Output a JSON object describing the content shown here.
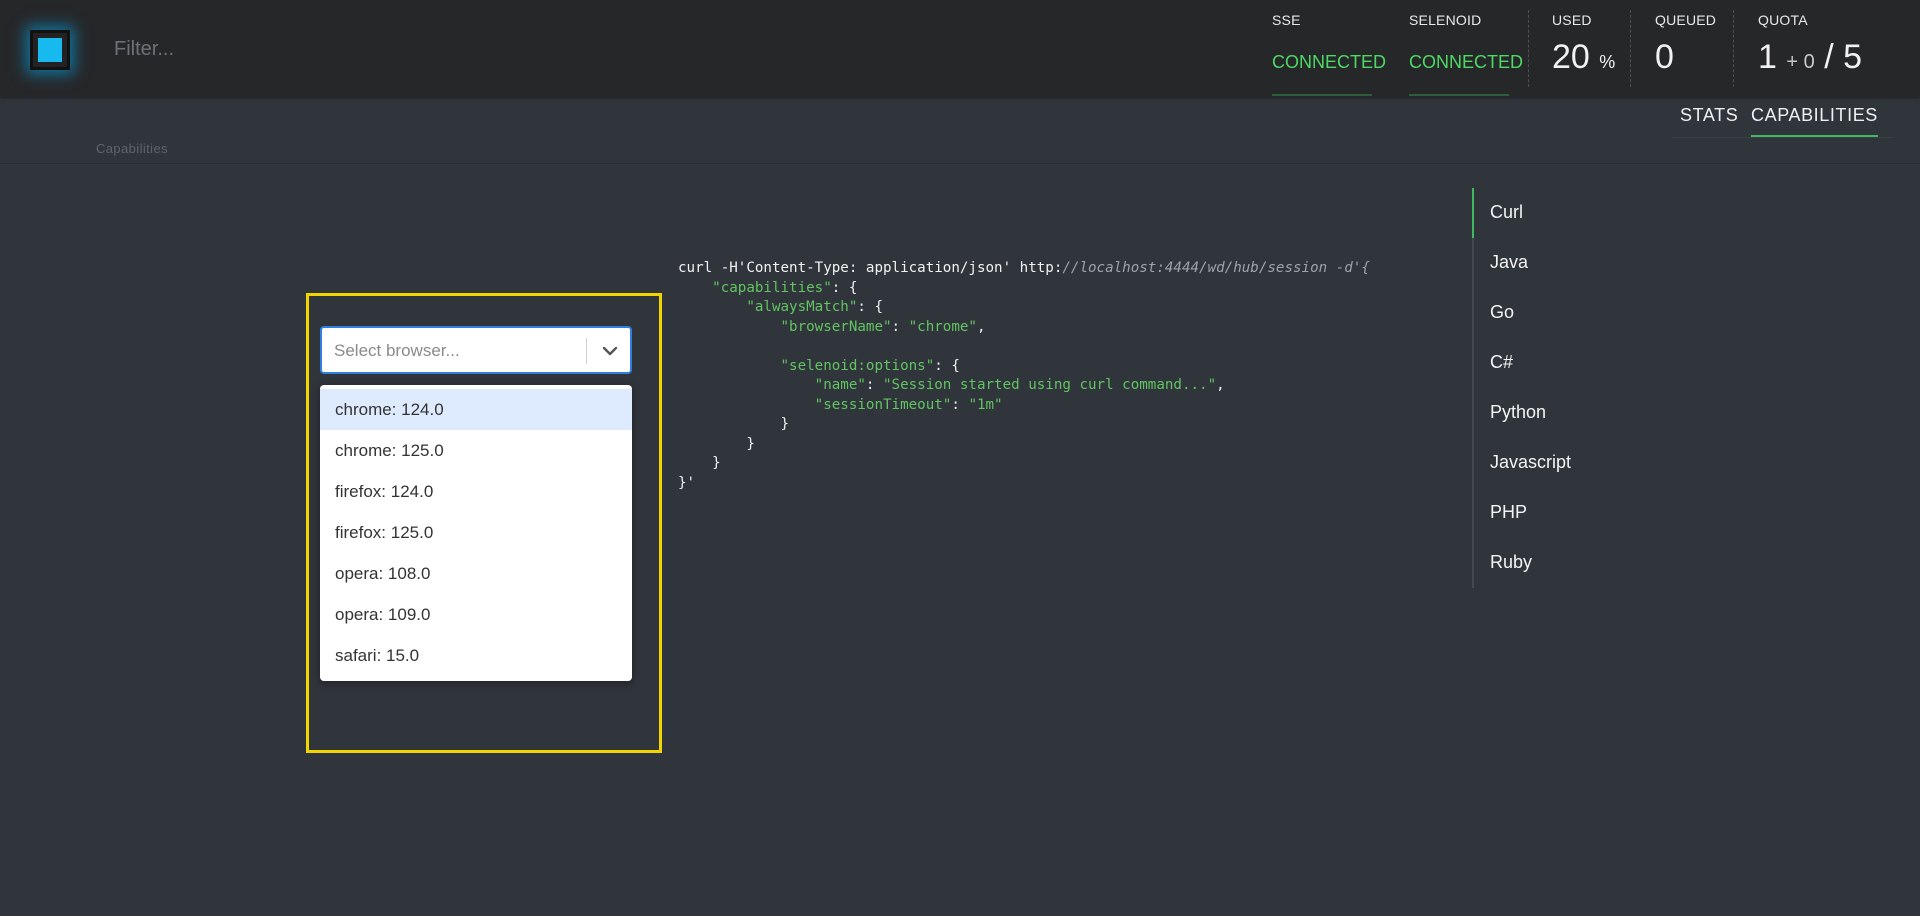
{
  "header": {
    "filter_placeholder": "Filter...",
    "sse": {
      "label": "SSE",
      "value": "CONNECTED"
    },
    "selenoid": {
      "label": "SELENOID",
      "value": "CONNECTED"
    },
    "used": {
      "label": "USED",
      "value": "20",
      "unit": "%"
    },
    "queued": {
      "label": "QUEUED",
      "value": "0"
    },
    "quota": {
      "label": "QUOTA",
      "value": "1",
      "plus": "+ 0",
      "total": "/ 5"
    }
  },
  "nav": {
    "breadcrumb": "Capabilities",
    "tabs": [
      {
        "label": "STATS",
        "active": false
      },
      {
        "label": "CAPABILITIES",
        "active": true
      }
    ]
  },
  "browser_select": {
    "placeholder": "Select browser...",
    "options": [
      "chrome: 124.0",
      "chrome: 125.0",
      "firefox: 124.0",
      "firefox: 125.0",
      "opera: 108.0",
      "opera: 109.0",
      "safari: 15.0"
    ],
    "focused_index": 0
  },
  "code": {
    "cmd": "curl -H'Content-Type: application/json' http:",
    "url": "//localhost:4444/wd/hub/session -d'{",
    "capabilities_key": "\"capabilities\"",
    "always_match_key": "\"alwaysMatch\"",
    "browser_name_key": "\"browserName\"",
    "browser_name_val": "\"chrome\"",
    "options_key": "\"selenoid:options\"",
    "name_key": "\"name\"",
    "name_val": "\"Session started using curl command...\"",
    "timeout_key": "\"sessionTimeout\"",
    "timeout_val": "\"1m\"",
    "end": "}'"
  },
  "languages": {
    "items": [
      "Curl",
      "Java",
      "Go",
      "C#",
      "Python",
      "Javascript",
      "PHP",
      "Ruby"
    ],
    "active": "Curl"
  },
  "colors": {
    "accent_green": "#4cd964",
    "highlight_frame": "#f2d500",
    "logo_blue": "#17b9ee"
  }
}
